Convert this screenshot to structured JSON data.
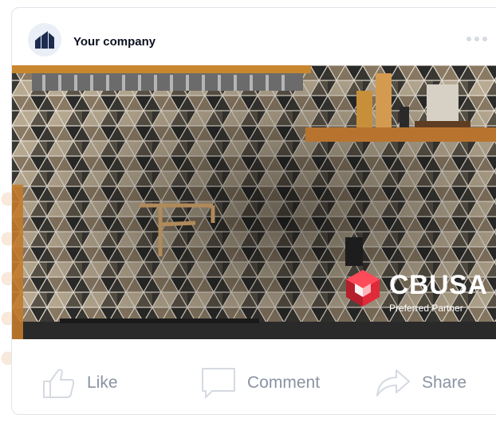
{
  "post": {
    "company_name": "Your company",
    "brand": {
      "name": "CBUSA",
      "tagline": "Preferred Partner",
      "accent_color": "#e02a3a"
    },
    "image": {
      "description": "kitchen backsplash with geometric tiles"
    },
    "actions": [
      {
        "label": "Like",
        "icon": "thumbs-up-icon"
      },
      {
        "label": "Comment",
        "icon": "comment-icon"
      },
      {
        "label": "Share",
        "icon": "share-icon"
      }
    ]
  },
  "colors": {
    "card_border": "#dfe3ea",
    "text_primary": "#0b1220",
    "action_text": "#8a93a3",
    "avatar_bg": "#e9eef7",
    "logo_navy": "#1d2b4f"
  }
}
